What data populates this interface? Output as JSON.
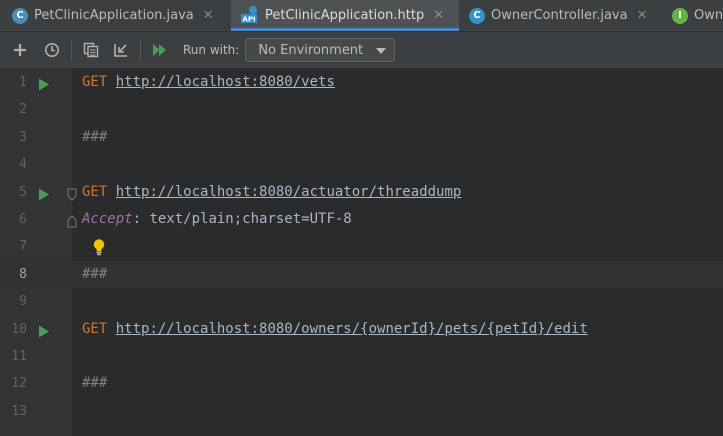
{
  "tabs": [
    {
      "label": "PetClinicApplication.java",
      "icon": "java-class-icon",
      "active": false
    },
    {
      "label": "PetClinicApplication.http",
      "icon": "api-icon",
      "active": true
    },
    {
      "label": "OwnerController.java",
      "icon": "class-icon",
      "active": false
    },
    {
      "label": "Own",
      "icon": "interface-icon",
      "active": false
    }
  ],
  "toolbar": {
    "run_with_label": "Run with:",
    "environment": "No Environment",
    "icons": [
      "add-icon",
      "history-icon",
      "copy-icon",
      "import-icon",
      "run-all-icon"
    ]
  },
  "editor": {
    "lines": [
      {
        "num": "1",
        "method": "GET",
        "url": "http://localhost:8080/vets",
        "run": true
      },
      {
        "num": "2"
      },
      {
        "num": "3",
        "comment": "###"
      },
      {
        "num": "4"
      },
      {
        "num": "5",
        "method": "GET",
        "url": "http://localhost:8080/actuator/threaddump",
        "run": true
      },
      {
        "num": "6",
        "header_name": "Accept",
        "header_sep": ":",
        "header_value": " text/plain;charset=UTF-8"
      },
      {
        "num": "7"
      },
      {
        "num": "8",
        "comment": "###",
        "current": true
      },
      {
        "num": "9"
      },
      {
        "num": "10",
        "method": "GET",
        "url": "http://localhost:8080/owners/{ownerId}/pets/{petId}/edit",
        "run": true
      },
      {
        "num": "11"
      },
      {
        "num": "12",
        "comment": "###"
      },
      {
        "num": "13"
      }
    ]
  },
  "colors": {
    "keyword": "#cc7832",
    "header_name": "#9876aa",
    "comment": "#808080",
    "run_arrow": "#499c54",
    "active_tab_underline": "#4a88c7"
  }
}
